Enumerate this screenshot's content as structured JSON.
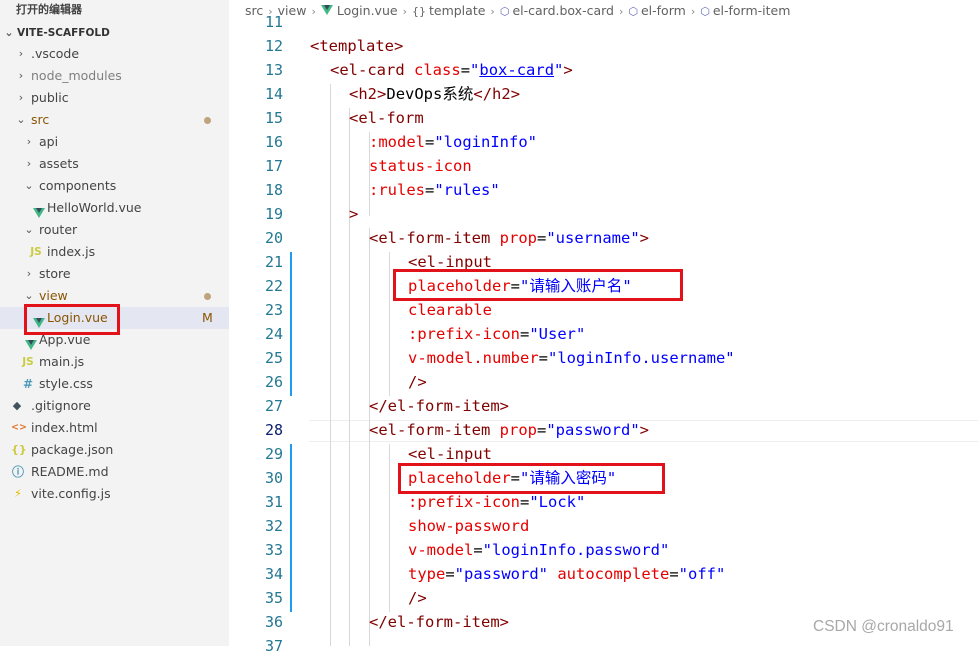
{
  "sidebar": {
    "section_title": "打开的编辑器",
    "root_folder": "VITE-SCAFFOLD",
    "items": {
      "vscode": ".vscode",
      "node_modules": "node_modules",
      "public": "public",
      "src": "src",
      "api": "api",
      "assets": "assets",
      "components": "components",
      "helloworld": "HelloWorld.vue",
      "router": "router",
      "router_index": "index.js",
      "store": "store",
      "view": "view",
      "login": "Login.vue",
      "login_status": "M",
      "app": "App.vue",
      "main": "main.js",
      "style": "style.css",
      "gitignore": ".gitignore",
      "index_html": "index.html",
      "package_json": "package.json",
      "readme": "README.md",
      "vite_config": "vite.config.js"
    },
    "icons": {
      "js": "JS",
      "css": "#",
      "html": "<>",
      "json": "{}",
      "readme": "ⓘ",
      "git": "◆",
      "vite": "⚡"
    }
  },
  "breadcrumb": {
    "items": [
      "src",
      "view",
      "Login.vue",
      "template",
      "el-card.box-card",
      "el-form",
      "el-form-item"
    ],
    "icons": [
      "",
      "",
      "vue-icon",
      "braces-icon",
      "element-icon",
      "element-icon",
      "element-icon"
    ]
  },
  "editor": {
    "active_line": "28",
    "line_numbers": [
      "11",
      "12",
      "13",
      "14",
      "15",
      "16",
      "17",
      "18",
      "19",
      "20",
      "21",
      "22",
      "23",
      "24",
      "25",
      "26",
      "27",
      "28",
      "29",
      "30",
      "31",
      "32",
      "33",
      "34",
      "35",
      "36",
      "37"
    ],
    "lines": {
      "l12": {
        "open": "<",
        "tag": "template",
        "close": ">"
      },
      "l13": {
        "open": "<",
        "tag": "el-card",
        "attr": "class",
        "eq": "=",
        "q1": "\"",
        "val": "box-card",
        "q2": "\"",
        "close": ">"
      },
      "l14": {
        "open": "<",
        "tag": "h2",
        "mid": ">",
        "text": "DevOps系统",
        "end_open": "</",
        "end_tag": "h2",
        "close": ">"
      },
      "l15": {
        "open": "<",
        "tag": "el-form"
      },
      "l16": {
        "attr": ":model",
        "eq": "=",
        "val": "\"loginInfo\""
      },
      "l17": {
        "attr": "status-icon"
      },
      "l18": {
        "attr": ":rules",
        "eq": "=",
        "val": "\"rules\""
      },
      "l19": {
        "close": ">"
      },
      "l20": {
        "open": "<",
        "tag": "el-form-item",
        "attr": "prop",
        "eq": "=",
        "val": "\"username\"",
        "close": ">"
      },
      "l21": {
        "open": "<",
        "tag": "el-input"
      },
      "l22": {
        "attr": "placeholder",
        "eq": "=",
        "val": "\"请输入账户名\""
      },
      "l23": {
        "attr": "clearable"
      },
      "l24": {
        "attr": ":prefix-icon",
        "eq": "=",
        "val": "\"User\""
      },
      "l25": {
        "attr": "v-model.number",
        "eq": "=",
        "val": "\"loginInfo.username\""
      },
      "l26": {
        "close": "/>"
      },
      "l27": {
        "open": "</",
        "tag": "el-form-item",
        "close": ">"
      },
      "l28": {
        "open": "<",
        "tag": "el-form-item",
        "attr": "prop",
        "eq": "=",
        "val": "\"password\"",
        "close": ">"
      },
      "l29": {
        "open": "<",
        "tag": "el-input"
      },
      "l30": {
        "attr": "placeholder",
        "eq": "=",
        "val": "\"请输入密码\""
      },
      "l31": {
        "attr": ":prefix-icon",
        "eq": "=",
        "val": "\"Lock\""
      },
      "l32": {
        "attr": "show-password"
      },
      "l33": {
        "attr": "v-model",
        "eq": "=",
        "val": "\"loginInfo.password\""
      },
      "l34": {
        "attr": "type",
        "eq": "=",
        "val": "\"password\"",
        "attr2": "autocomplete",
        "eq2": "=",
        "val2": "\"off\""
      },
      "l35": {
        "close": "/>"
      },
      "l36": {
        "open": "</",
        "tag": "el-form-item",
        "close": ">"
      }
    }
  },
  "watermark": "CSDN @cronaldo91",
  "colors": {
    "tag": "#800000",
    "attribute": "#e50000",
    "string": "#0000ff",
    "line_number": "#237893",
    "highlight_box": "#e2121b",
    "modified": "#895503"
  }
}
